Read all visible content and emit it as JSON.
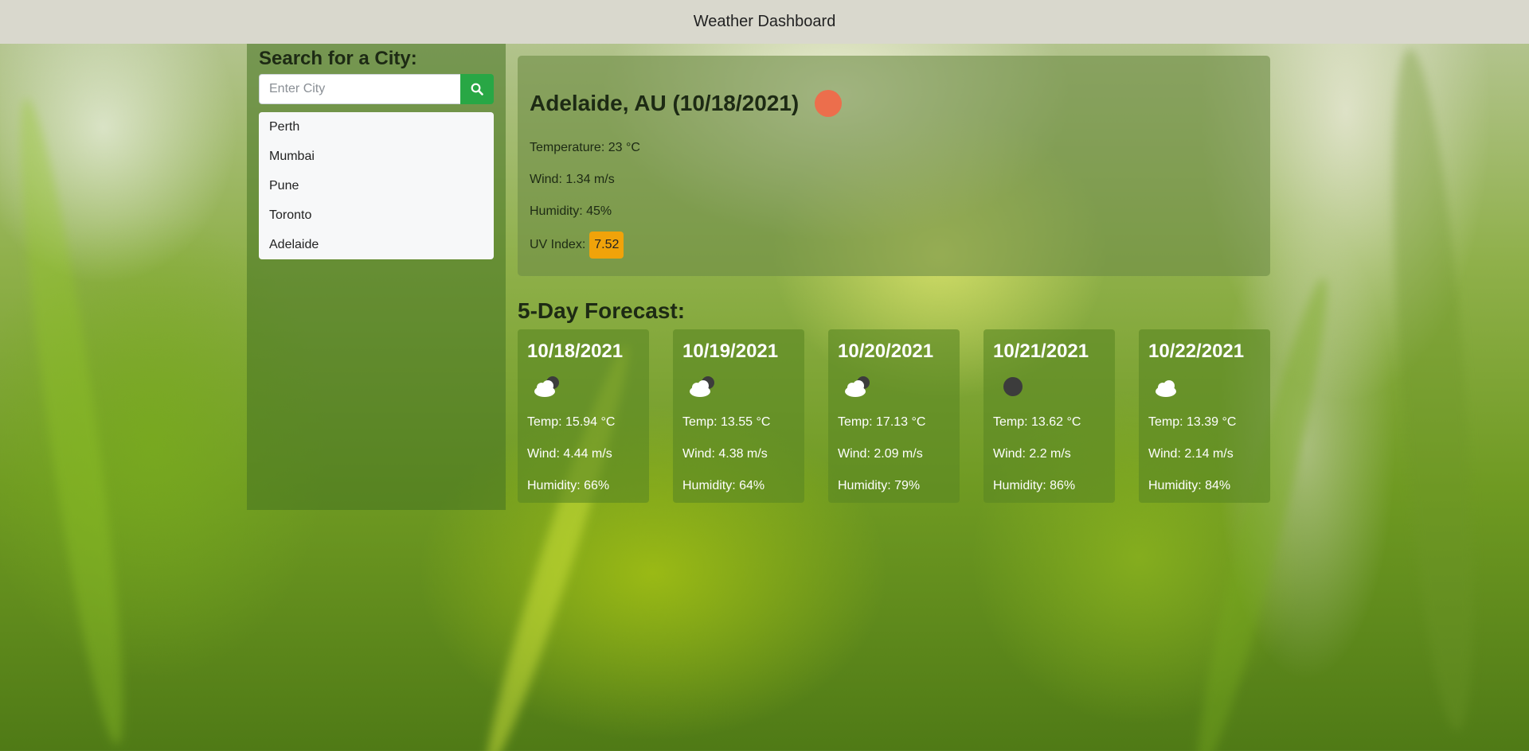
{
  "navbar": {
    "title": "Weather Dashboard"
  },
  "sidebar": {
    "heading": "Search for a City:",
    "search_placeholder": "Enter City",
    "search_icon": "search-icon",
    "history": [
      "Perth",
      "Mumbai",
      "Pune",
      "Toronto",
      "Adelaide"
    ]
  },
  "current": {
    "title": "Adelaide, AU (10/18/2021)",
    "icon": "sun-icon",
    "temperature": "Temperature: 23 °C",
    "wind": "Wind: 1.34 m/s",
    "humidity": "Humidity: 45%",
    "uv_label": "UV Index:",
    "uv_value": "7.52",
    "uv_color": "#f0a30a"
  },
  "forecast": {
    "heading": "5-Day Forecast:",
    "days": [
      {
        "date": "10/18/2021",
        "icon": "partly-cloudy-icon",
        "temp": "Temp: 15.94 °C",
        "wind": "Wind: 4.44 m/s",
        "humidity": "Humidity: 66%"
      },
      {
        "date": "10/19/2021",
        "icon": "partly-cloudy-icon",
        "temp": "Temp: 13.55 °C",
        "wind": "Wind: 4.38 m/s",
        "humidity": "Humidity: 64%"
      },
      {
        "date": "10/20/2021",
        "icon": "partly-cloudy-icon",
        "temp": "Temp: 17.13 °C",
        "wind": "Wind: 2.09 m/s",
        "humidity": "Humidity: 79%"
      },
      {
        "date": "10/21/2021",
        "icon": "overcast-icon",
        "temp": "Temp: 13.62 °C",
        "wind": "Wind: 2.2 m/s",
        "humidity": "Humidity: 86%"
      },
      {
        "date": "10/22/2021",
        "icon": "cloud-icon",
        "temp": "Temp: 13.39 °C",
        "wind": "Wind: 2.14 m/s",
        "humidity": "Humidity: 84%"
      }
    ]
  },
  "colors": {
    "navbar_bg": "#d9d8cd",
    "search_button": "#28a745",
    "sun_icon": "#ec6e4c"
  }
}
